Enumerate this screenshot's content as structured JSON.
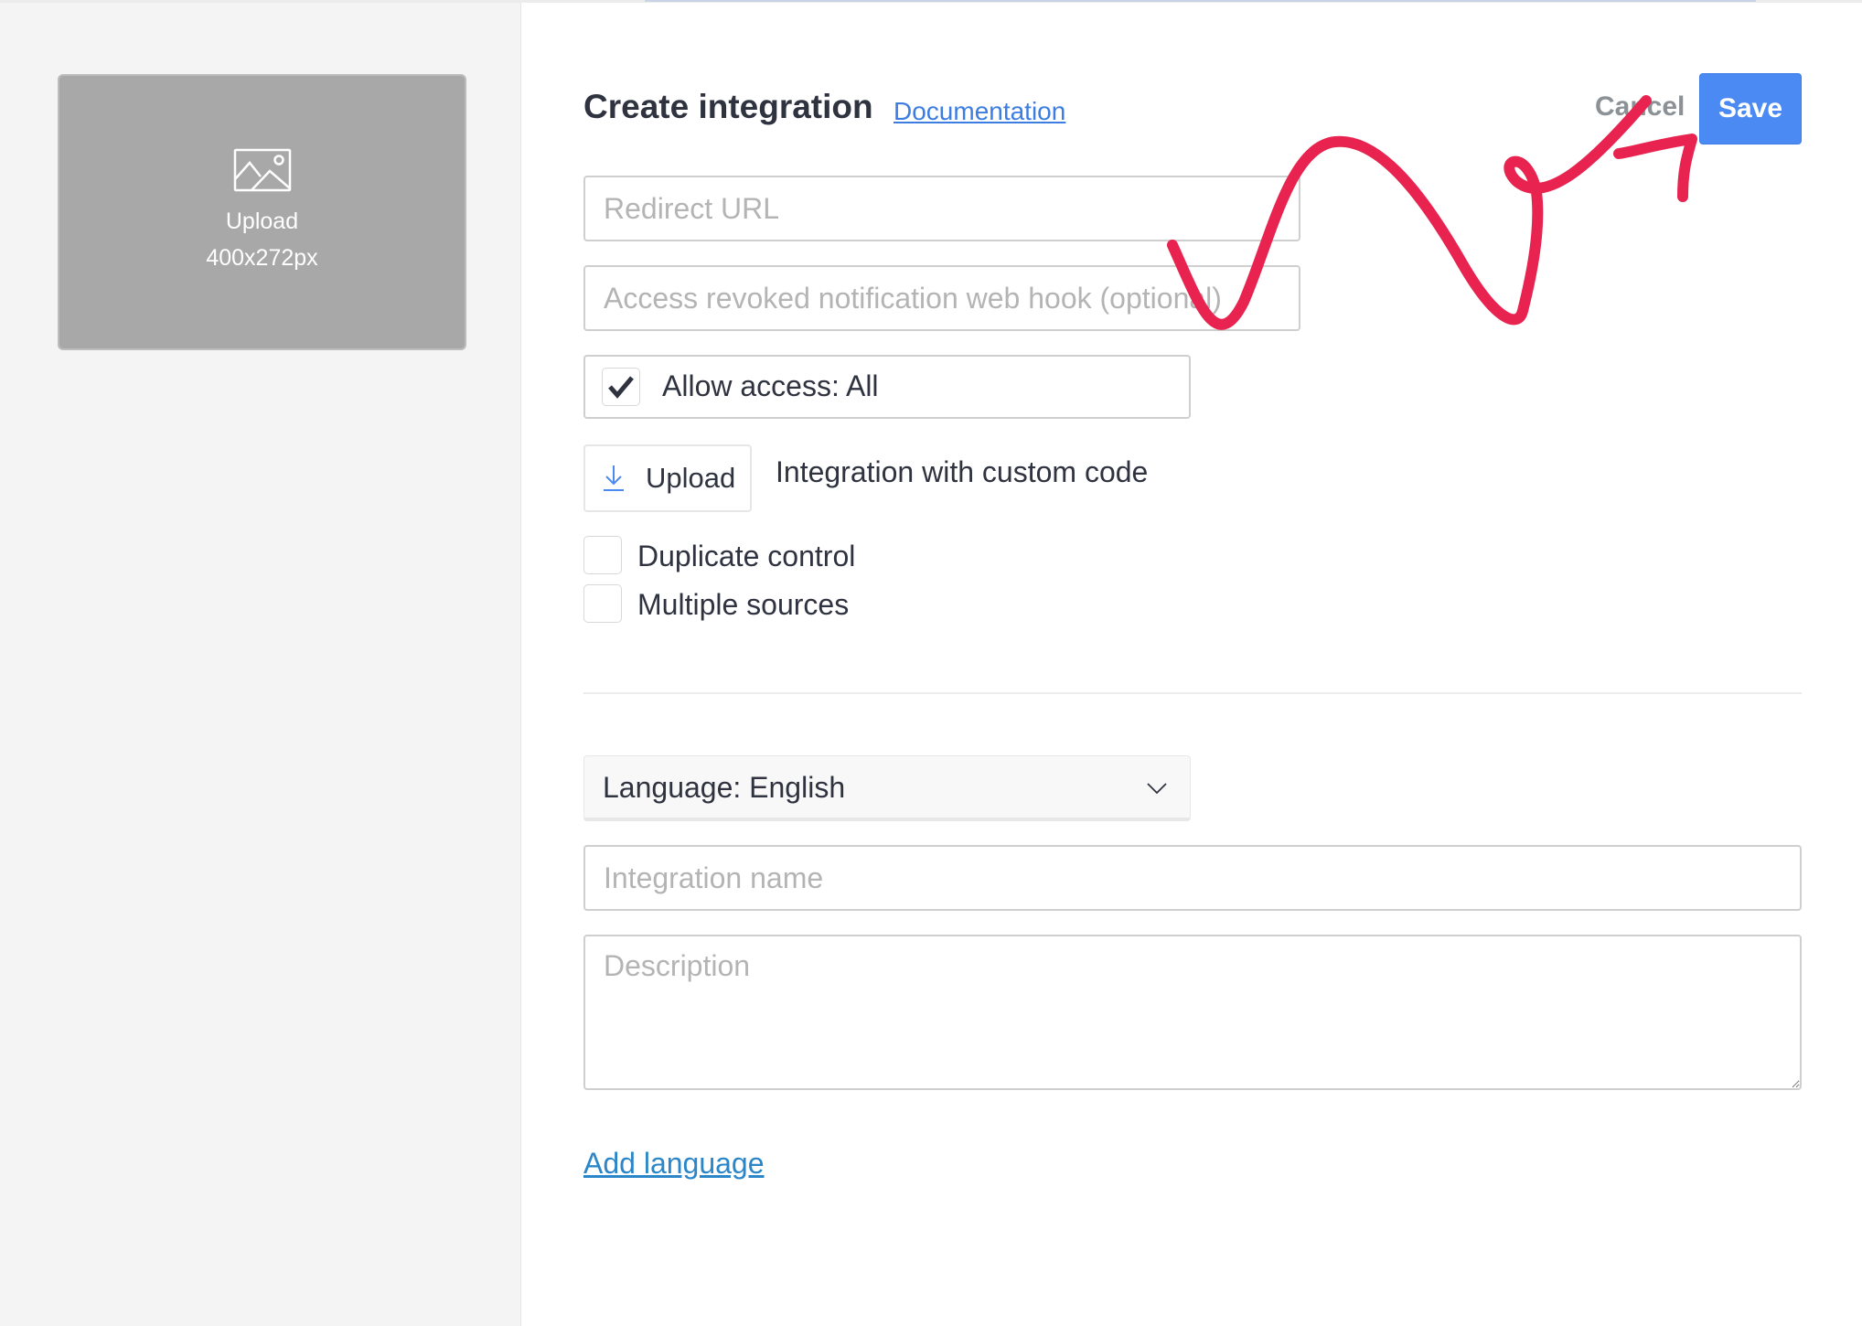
{
  "sidebar": {
    "image_upload": {
      "label": "Upload",
      "size_hint": "400x272px",
      "icon": "image-icon"
    }
  },
  "header": {
    "title": "Create integration",
    "documentation_link": "Documentation",
    "cancel_label": "Cancel",
    "save_label": "Save"
  },
  "form": {
    "redirect_url": {
      "value": "",
      "placeholder": "Redirect URL"
    },
    "webhook": {
      "value": "",
      "placeholder": "Access revoked notification web hook (optional)"
    },
    "allow_access": {
      "label": "Allow access: All",
      "checked": true
    },
    "upload_button": {
      "label": "Upload",
      "icon": "download-arrow-icon"
    },
    "custom_code_label": "Integration with custom code",
    "checkboxes": [
      {
        "label": "Duplicate control",
        "checked": false
      },
      {
        "label": "Multiple sources",
        "checked": false
      }
    ],
    "language_select": {
      "label": "Language: English",
      "icon": "chevron-down-icon"
    },
    "integration_name": {
      "value": "",
      "placeholder": "Integration name"
    },
    "description": {
      "value": "",
      "placeholder": "Description"
    },
    "add_language_link": "Add language"
  },
  "colors": {
    "primary": "#4b8af2",
    "link": "#3b7de0",
    "annotation": "#e8234f",
    "sidebar_bg": "#f4f4f4",
    "upload_tile_bg": "#a8a8a8"
  }
}
